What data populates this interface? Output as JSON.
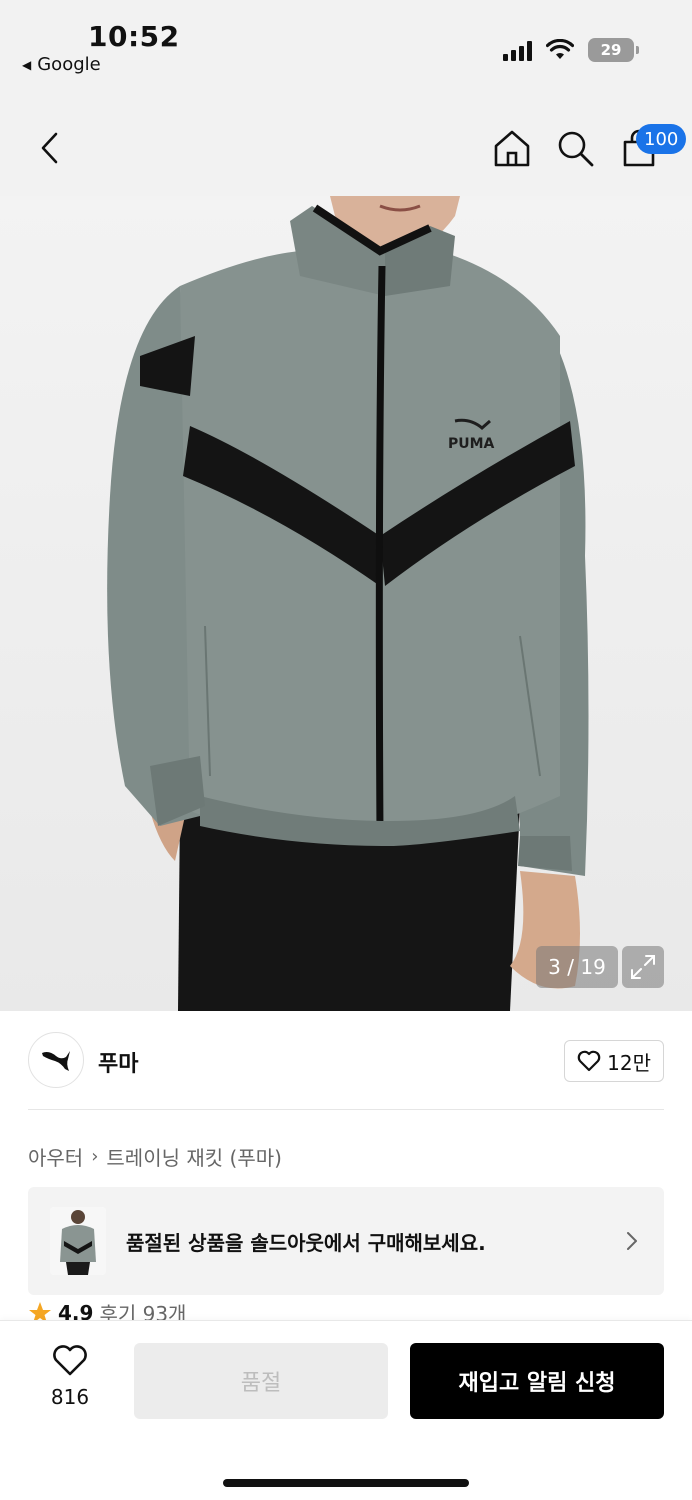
{
  "status_bar": {
    "time": "10:52",
    "back_app": "Google",
    "battery": "29"
  },
  "nav": {
    "cart_count": "100"
  },
  "gallery": {
    "counter": "3 / 19",
    "brand_mark_on_jacket": "PUMA"
  },
  "brand": {
    "name": "푸마",
    "likes": "12만"
  },
  "breadcrumb": {
    "category": "아우터",
    "product": "트레이닝 재킷 (푸마)"
  },
  "banner": {
    "text": "품절된 상품을 솔드아웃에서 구매해보세요."
  },
  "rating": {
    "score": "4.9",
    "reviews": "후기 93개"
  },
  "actions": {
    "wish_count": "816",
    "soldout_label": "품절",
    "restock_label": "재입고 알림 신청"
  },
  "colors": {
    "badge": "#1a73e8",
    "jacket": "#7d8a87",
    "stripe": "#141414",
    "star": "#f5a623",
    "primary_button": "#000000"
  }
}
